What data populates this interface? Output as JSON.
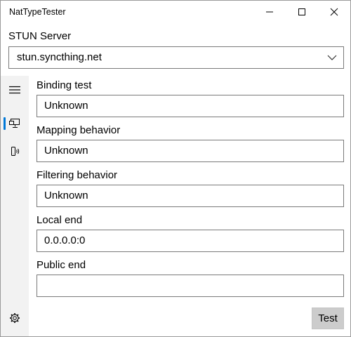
{
  "window": {
    "title": "NatTypeTester",
    "controls": {
      "minimize_icon": "minimize-icon",
      "maximize_icon": "maximize-icon",
      "close_icon": "close-icon"
    }
  },
  "stun": {
    "label": "STUN Server",
    "selected": "stun.syncthing.net",
    "dropdown_icon": "chevron-down-icon"
  },
  "nav": {
    "items": [
      {
        "icon": "hamburger-menu-icon",
        "selected": false
      },
      {
        "icon": "monitor-icon",
        "selected": true
      },
      {
        "icon": "server-icon",
        "selected": false
      },
      {
        "icon": "gear-icon",
        "selected": false
      }
    ],
    "accent_color": "#0078d7"
  },
  "fields": {
    "binding_test": {
      "label": "Binding test",
      "value": "Unknown"
    },
    "mapping_behavior": {
      "label": "Mapping behavior",
      "value": "Unknown"
    },
    "filtering_behavior": {
      "label": "Filtering behavior",
      "value": "Unknown"
    },
    "local_end": {
      "label": "Local end",
      "value": "0.0.0.0:0"
    },
    "public_end": {
      "label": "Public end",
      "value": ""
    }
  },
  "actions": {
    "test_label": "Test"
  }
}
